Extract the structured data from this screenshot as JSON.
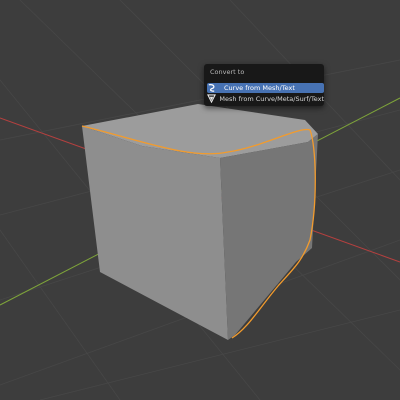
{
  "app": "Blender 3D Viewport",
  "colors": {
    "background": "#3d3d3d",
    "grid": "#4a4a4a",
    "x_axis": "#b5403f",
    "y_axis": "#7ea43a",
    "cube_top": "#999999",
    "cube_left": "#8d8d8d",
    "cube_right": "#747474",
    "selection_outline": "#f29b2d",
    "menu_background": "#181818",
    "menu_highlight": "#4772b3"
  },
  "convert_menu": {
    "title": "Convert to",
    "items": [
      {
        "label": "Curve from Mesh/Text",
        "icon": "curve-icon",
        "highlighted": true
      },
      {
        "label": "Mesh from Curve/Meta/Surf/Text",
        "icon": "mesh-icon",
        "highlighted": false
      }
    ]
  }
}
